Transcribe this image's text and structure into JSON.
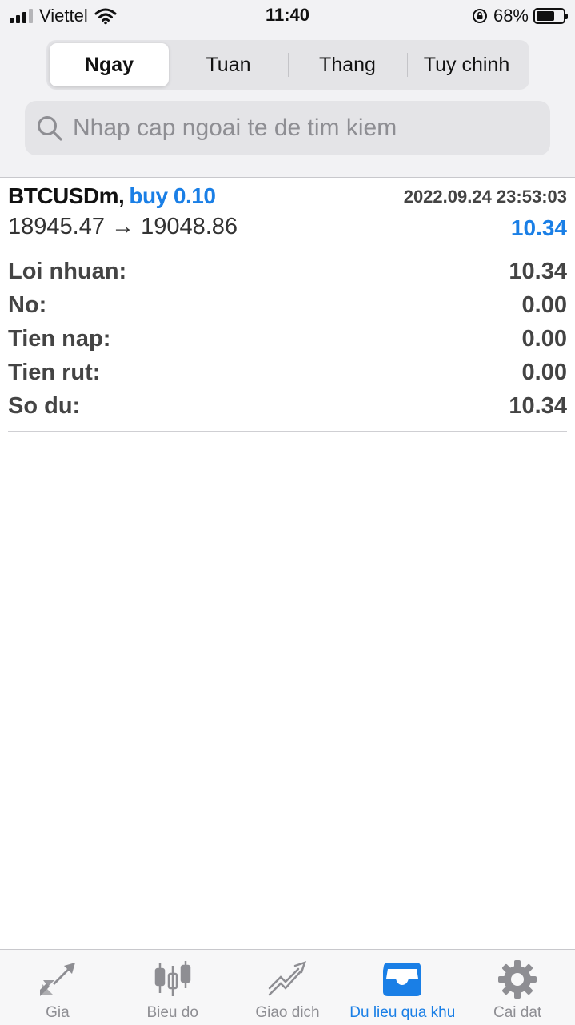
{
  "status_bar": {
    "carrier": "Viettel",
    "time": "11:40",
    "battery_percent": "68%",
    "battery_level": 0.68,
    "signal_bars": 3
  },
  "period_tabs": {
    "items": [
      "Ngay",
      "Tuan",
      "Thang",
      "Tuy chinh"
    ],
    "selected": "Ngay"
  },
  "search": {
    "placeholder": "Nhap cap ngoai te de tim kiem",
    "value": ""
  },
  "deal": {
    "symbol": "BTCUSDm,",
    "direction": "buy 0.10",
    "time": "2022.09.24 23:53:03",
    "prices": "18945.47 → 19048.86",
    "profit": "10.34"
  },
  "summary": [
    {
      "label": "Loi nhuan:",
      "value": "10.34"
    },
    {
      "label": "No:",
      "value": "0.00"
    },
    {
      "label": "Tien nap:",
      "value": "0.00"
    },
    {
      "label": "Tien rut:",
      "value": "0.00"
    },
    {
      "label": "So du:",
      "value": "10.34"
    }
  ],
  "tab_bar": {
    "items": [
      {
        "label": "Gia",
        "icon": "quotes-arrows-icon"
      },
      {
        "label": "Bieu do",
        "icon": "candlestick-chart-icon"
      },
      {
        "label": "Giao dich",
        "icon": "trade-chart-icon"
      },
      {
        "label": "Du lieu qua khu",
        "icon": "history-inbox-icon"
      },
      {
        "label": "Cai dat",
        "icon": "settings-gear-icon"
      }
    ],
    "selected": "Du lieu qua khu"
  },
  "colors": {
    "accent": "#1a7fe6",
    "inactive": "#8e8e93"
  }
}
